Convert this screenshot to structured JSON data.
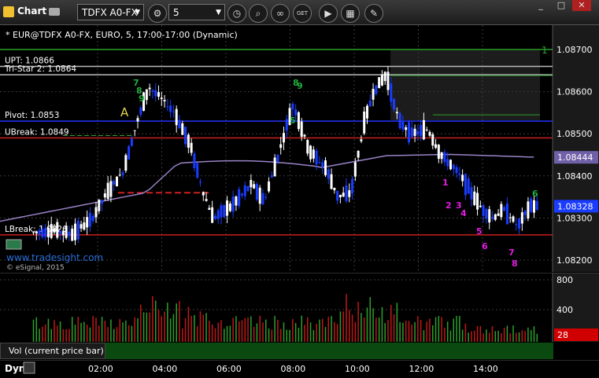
{
  "toolbar": {
    "app_title": "Chart",
    "symbol": "TDFX A0-FX",
    "interval": "5",
    "link_badge": "GET",
    "window_min": "_",
    "window_max": "□",
    "window_close": "✕"
  },
  "header": {
    "description": "* EUR@TDFX A0-FX, EURO, 5, 17:00-17:00 (Dynamic)"
  },
  "levels": [
    {
      "label": "UPT: 1.0866",
      "value": 1.0866
    },
    {
      "label": "Tri-Star 2: 1.0864",
      "value": 1.0864
    },
    {
      "label": "Pivot: 1.0853",
      "value": 1.0853
    },
    {
      "label": "UBreak: 1.0849",
      "value": 1.0849
    },
    {
      "label": "LBreak: 1.0826",
      "value": 1.0826
    }
  ],
  "price_axis": {
    "ticks": [
      "1.08700",
      "1.08600",
      "1.08500",
      "1.08400",
      "1.08300",
      "1.08200"
    ],
    "ma_label": "1.08444",
    "last_label": "1.08328"
  },
  "volume_axis": {
    "ticks": [
      "800",
      "400"
    ],
    "current": "28"
  },
  "time_axis": [
    "02:00",
    "04:00",
    "06:00",
    "08:00",
    "10:00",
    "12:00",
    "14:00"
  ],
  "watermark": {
    "site": "www.tradesight.com",
    "copyright": "© eSignal, 2015"
  },
  "annotations": {
    "pattern_letter": "A",
    "right_digit": "1"
  },
  "vol_label": "Vol (current price bar)",
  "footer": {
    "mode": "Dyn"
  },
  "colors": {
    "up": "#ffffff",
    "down": "#1a3cff",
    "ma": "#9b82c8",
    "level_green": "#2ca02c",
    "level_blue": "#2233ff",
    "level_red": "#c81e1e",
    "setup_green": "#1fae3c",
    "countdown_magenta": "#e01ee0",
    "vol_up": "#2ca02c",
    "vol_down": "#c01818"
  },
  "chart_data": [
    {
      "type": "candlestick",
      "ylim": [
        1.0816,
        1.0876
      ],
      "x_ticks": [
        "02:00",
        "04:00",
        "06:00",
        "08:00",
        "10:00",
        "12:00",
        "14:00"
      ],
      "moving_average_last": 1.08444,
      "last_price": 1.08328,
      "setup_counts": [
        {
          "label": "7",
          "near": "03:45"
        },
        {
          "label": "8",
          "near": "03:50"
        },
        {
          "label": "9",
          "near": "03:55"
        },
        {
          "label": "8",
          "near": "08:00"
        },
        {
          "label": "9",
          "near": "08:05"
        },
        {
          "label": "5",
          "near": "07:50"
        },
        {
          "label": "6",
          "near": "14:55"
        }
      ],
      "countdown_labels": [
        "1",
        "2",
        "3",
        "4",
        "5",
        "6",
        "7",
        "8"
      ]
    },
    {
      "type": "bar",
      "name": "Vol (current price bar)",
      "ylim": [
        0,
        800
      ],
      "current": 28
    }
  ]
}
